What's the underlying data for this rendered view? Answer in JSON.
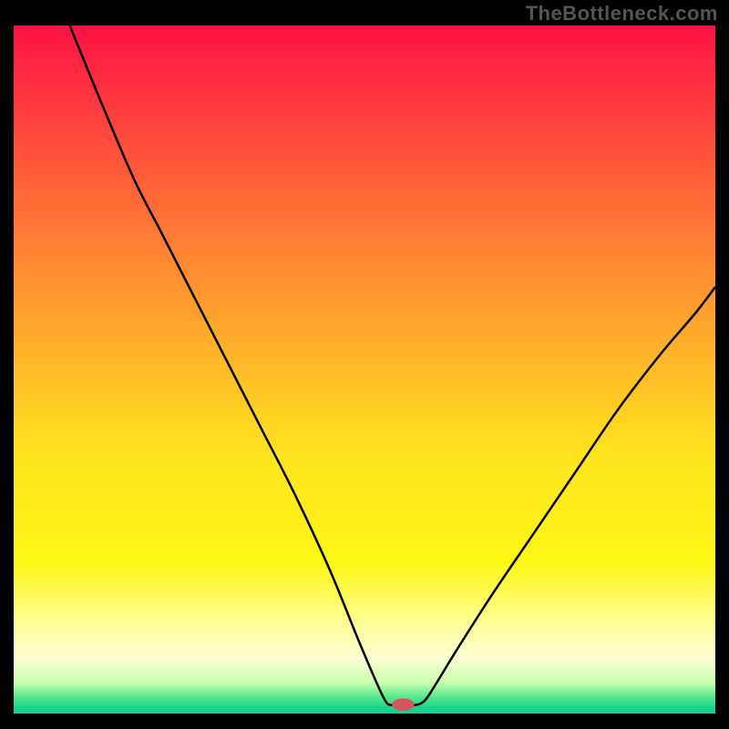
{
  "watermark": "TheBottleneck.com",
  "chart_data": {
    "type": "line",
    "title": "",
    "xlabel": "",
    "ylabel": "",
    "xlim": [
      0,
      100
    ],
    "ylim": [
      0,
      100
    ],
    "background_gradient": {
      "stops": [
        {
          "offset": 0.0,
          "color": "#ff1342"
        },
        {
          "offset": 0.12,
          "color": "#ff3b3e"
        },
        {
          "offset": 0.3,
          "color": "#ff7a34"
        },
        {
          "offset": 0.48,
          "color": "#ffb52a"
        },
        {
          "offset": 0.62,
          "color": "#ffe31f"
        },
        {
          "offset": 0.78,
          "color": "#fff714"
        },
        {
          "offset": 0.88,
          "color": "#fdffa6"
        },
        {
          "offset": 0.92,
          "color": "#fbffd0"
        },
        {
          "offset": 0.955,
          "color": "#c9ffb0"
        },
        {
          "offset": 0.975,
          "color": "#5ce88e"
        },
        {
          "offset": 0.99,
          "color": "#1fd98b"
        },
        {
          "offset": 1.0,
          "color": "#18d18a"
        }
      ]
    },
    "series": [
      {
        "name": "bottleneck-curve",
        "color": "#000000",
        "stroke_width": 2.5,
        "points": [
          {
            "x": 8.0,
            "y": 100.0
          },
          {
            "x": 12.0,
            "y": 90.0
          },
          {
            "x": 17.0,
            "y": 78.0
          },
          {
            "x": 21.0,
            "y": 70.0
          },
          {
            "x": 25.0,
            "y": 62.0
          },
          {
            "x": 30.0,
            "y": 52.0
          },
          {
            "x": 35.0,
            "y": 42.0
          },
          {
            "x": 40.0,
            "y": 32.0
          },
          {
            "x": 45.0,
            "y": 21.0
          },
          {
            "x": 49.0,
            "y": 11.0
          },
          {
            "x": 51.5,
            "y": 5.0
          },
          {
            "x": 53.0,
            "y": 1.8
          },
          {
            "x": 54.0,
            "y": 1.2
          },
          {
            "x": 57.0,
            "y": 1.2
          },
          {
            "x": 58.5,
            "y": 1.8
          },
          {
            "x": 60.0,
            "y": 4.0
          },
          {
            "x": 63.0,
            "y": 9.0
          },
          {
            "x": 68.0,
            "y": 17.0
          },
          {
            "x": 74.0,
            "y": 26.0
          },
          {
            "x": 80.0,
            "y": 35.0
          },
          {
            "x": 86.0,
            "y": 44.0
          },
          {
            "x": 92.0,
            "y": 52.0
          },
          {
            "x": 97.0,
            "y": 58.0
          },
          {
            "x": 100.0,
            "y": 62.0
          }
        ]
      }
    ],
    "marker": {
      "name": "optimal-point",
      "x": 55.5,
      "y": 1.3,
      "rx": 1.6,
      "ry": 0.9,
      "color": "#d4565e"
    }
  }
}
